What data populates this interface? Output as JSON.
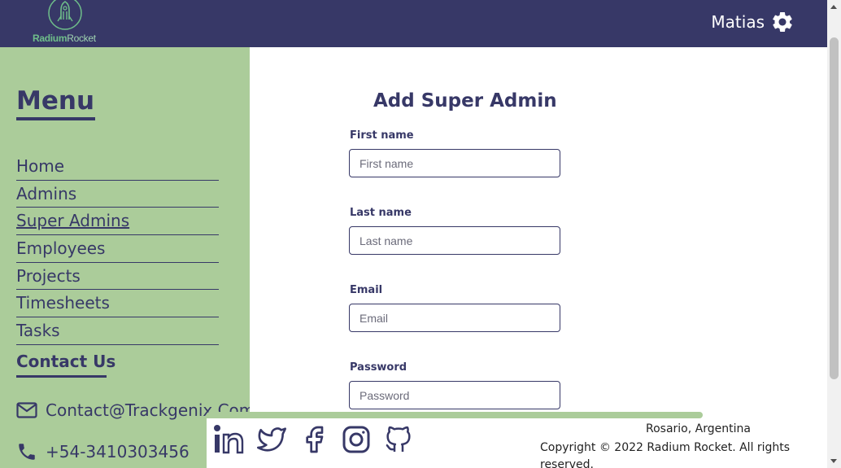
{
  "header": {
    "logo": {
      "text_primary": "Radium",
      "text_secondary": "Rocket",
      "icon": "rocket-logo-icon"
    },
    "user_name": "Matias",
    "settings_icon": "gear-icon"
  },
  "sidebar": {
    "menu_title": "Menu",
    "items": [
      {
        "label": "Home",
        "active": false
      },
      {
        "label": "Admins",
        "active": false
      },
      {
        "label": "Super Admins",
        "active": true
      },
      {
        "label": "Employees",
        "active": false
      },
      {
        "label": "Projects",
        "active": false
      },
      {
        "label": "Timesheets",
        "active": false
      },
      {
        "label": "Tasks",
        "active": false
      }
    ],
    "contact_title": "Contact Us",
    "email": "Contact@Trackgenix.Com",
    "phone": "+54-3410303456"
  },
  "form": {
    "title": "Add Super Admin",
    "fields": [
      {
        "label": "First name",
        "placeholder": "First name",
        "value": ""
      },
      {
        "label": "Last name",
        "placeholder": "Last name",
        "value": ""
      },
      {
        "label": "Email",
        "placeholder": "Email",
        "value": ""
      },
      {
        "label": "Password",
        "placeholder": "Password",
        "value": ""
      }
    ]
  },
  "footer": {
    "socials": [
      "linkedin-icon",
      "twitter-icon",
      "facebook-icon",
      "instagram-icon",
      "github-icon"
    ],
    "location": "Rosario, Argentina",
    "copyright": "Copyright © 2022 Radium Rocket. All rights reserved."
  },
  "colors": {
    "primary": "#373867",
    "sidebar": "#abcc9a",
    "background": "#ffffff"
  }
}
